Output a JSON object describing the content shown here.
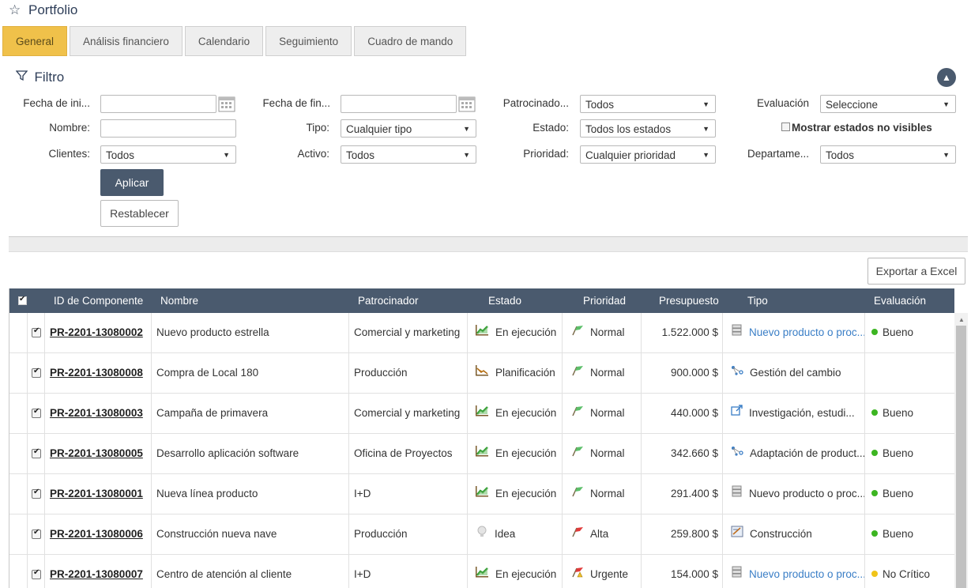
{
  "header": {
    "title": "Portfolio",
    "star_icon": "star-icon"
  },
  "tabs": [
    {
      "label": "General",
      "active": true
    },
    {
      "label": "Análisis financiero"
    },
    {
      "label": "Calendario"
    },
    {
      "label": "Seguimiento"
    },
    {
      "label": "Cuadro de mando"
    }
  ],
  "filter": {
    "title": "Filtro",
    "fields": {
      "fecha_inicio": {
        "label": "Fecha de ini...",
        "value": ""
      },
      "fecha_fin": {
        "label": "Fecha de fin...",
        "value": ""
      },
      "patrocinador": {
        "label": "Patrocinado...",
        "value": "Todos"
      },
      "evaluacion": {
        "label": "Evaluación",
        "value": "Seleccione"
      },
      "nombre": {
        "label": "Nombre:",
        "value": ""
      },
      "tipo": {
        "label": "Tipo:",
        "value": "Cualquier tipo"
      },
      "estado": {
        "label": "Estado:",
        "value": "Todos los estados"
      },
      "mostrar_no_visibles": {
        "label": "Mostrar estados no visibles",
        "checked": false
      },
      "clientes": {
        "label": "Clientes:",
        "value": "Todos"
      },
      "activo": {
        "label": "Activo:",
        "value": "Todos"
      },
      "prioridad": {
        "label": "Prioridad:",
        "value": "Cualquier prioridad"
      },
      "departamento": {
        "label": "Departame...",
        "value": "Todos"
      }
    },
    "apply_label": "Aplicar",
    "reset_label": "Restablecer"
  },
  "export_label": "Exportar a Excel",
  "table": {
    "columns": [
      "ID de Componente",
      "Nombre",
      "Patrocinador",
      "Estado",
      "Prioridad",
      "Presupuesto",
      "Tipo",
      "Evaluación"
    ],
    "rows": [
      {
        "id": "PR-2201-13080002",
        "nombre": "Nuevo producto estrella",
        "patrocinador": "Comercial y marketing",
        "estado": "En ejecución",
        "estado_icon": "chart-up-icon",
        "prioridad": "Normal",
        "prioridad_icon": "flag-green-icon",
        "presupuesto": "1.522.000 $",
        "tipo": "Nuevo producto o proc...",
        "tipo_link": true,
        "tipo_icon": "server-icon",
        "evaluacion": "Bueno",
        "eval_color": "#3cb521"
      },
      {
        "id": "PR-2201-13080008",
        "nombre": "Compra de Local 180",
        "patrocinador": "Producción",
        "estado": "Planificación",
        "estado_icon": "planning-chart-icon",
        "prioridad": "Normal",
        "prioridad_icon": "flag-green-icon",
        "presupuesto": "900.000 $",
        "tipo": "Gestión del cambio",
        "tipo_link": false,
        "tipo_icon": "nodes-icon",
        "evaluacion": "",
        "eval_color": ""
      },
      {
        "id": "PR-2201-13080003",
        "nombre": "Campaña de primavera",
        "patrocinador": "Comercial y marketing",
        "estado": "En ejecución",
        "estado_icon": "chart-up-icon",
        "prioridad": "Normal",
        "prioridad_icon": "flag-green-icon",
        "presupuesto": "440.000 $",
        "tipo": "Investigación, estudi...",
        "tipo_link": false,
        "tipo_icon": "external-link-icon",
        "evaluacion": "Bueno",
        "eval_color": "#3cb521"
      },
      {
        "id": "PR-2201-13080005",
        "nombre": "Desarrollo aplicación software",
        "patrocinador": "Oficina de Proyectos",
        "estado": "En ejecución",
        "estado_icon": "chart-up-icon",
        "prioridad": "Normal",
        "prioridad_icon": "flag-green-icon",
        "presupuesto": "342.660 $",
        "tipo": "Adaptación de product...",
        "tipo_link": false,
        "tipo_icon": "nodes-icon",
        "evaluacion": "Bueno",
        "eval_color": "#3cb521"
      },
      {
        "id": "PR-2201-13080001",
        "nombre": "Nueva línea producto",
        "patrocinador": "I+D",
        "estado": "En ejecución",
        "estado_icon": "chart-up-icon",
        "prioridad": "Normal",
        "prioridad_icon": "flag-green-icon",
        "presupuesto": "291.400 $",
        "tipo": "Nuevo producto o proc...",
        "tipo_link": false,
        "tipo_icon": "server-icon",
        "evaluacion": "Bueno",
        "eval_color": "#3cb521"
      },
      {
        "id": "PR-2201-13080006",
        "nombre": "Construcción nueva nave",
        "patrocinador": "Producción",
        "estado": "Idea",
        "estado_icon": "idea-icon",
        "prioridad": "Alta",
        "prioridad_icon": "flag-red-icon",
        "presupuesto": "259.800 $",
        "tipo": "Construcción",
        "tipo_link": false,
        "tipo_icon": "blueprint-icon",
        "evaluacion": "Bueno",
        "eval_color": "#3cb521"
      },
      {
        "id": "PR-2201-13080007",
        "nombre": "Centro de atención al cliente",
        "patrocinador": "I+D",
        "estado": "En ejecución",
        "estado_icon": "chart-up-icon",
        "prioridad": "Urgente",
        "prioridad_icon": "flag-warning-icon",
        "presupuesto": "154.000 $",
        "tipo": "Nuevo producto o proc...",
        "tipo_link": true,
        "tipo_icon": "server-icon",
        "evaluacion": "No Crítico",
        "eval_color": "#f0c419"
      }
    ]
  }
}
